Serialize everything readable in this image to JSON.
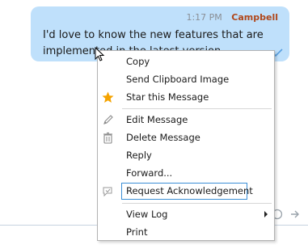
{
  "message": {
    "time": "1:17 PM",
    "sender": "Campbell",
    "text": "I'd love to know the new features that are implemented in the latest version."
  },
  "menu": {
    "items": [
      {
        "label": "Copy",
        "icon": ""
      },
      {
        "label": "Send Clipboard Image",
        "icon": ""
      },
      {
        "label": "Star this Message",
        "icon": "star-icon"
      },
      {
        "label": "Edit Message",
        "icon": "pencil-icon"
      },
      {
        "label": "Delete Message",
        "icon": "trash-icon"
      },
      {
        "label": "Reply",
        "icon": ""
      },
      {
        "label": "Forward...",
        "icon": ""
      },
      {
        "label": "Request Acknowledgement",
        "icon": "acknowledge-icon"
      },
      {
        "label": "View Log",
        "icon": "submenu-arrow"
      },
      {
        "label": "Print",
        "icon": ""
      }
    ]
  },
  "colors": {
    "bubble": "#bfe0fb",
    "sender": "#b0471b",
    "star": "#f5a300",
    "focus": "#3c8fd6"
  }
}
